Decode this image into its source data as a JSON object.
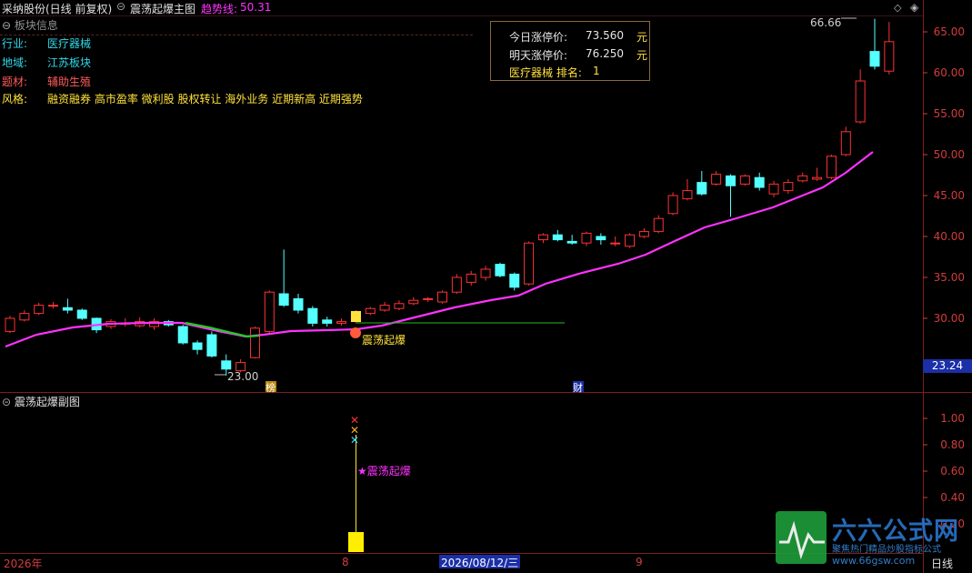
{
  "title_bar": {
    "stock": "采纳股份(日线 前复权)",
    "indicator_main": "震荡起爆主图",
    "trend_label": "趋势线:",
    "trend_value": "50.31"
  },
  "sector_panel": {
    "title": "板块信息",
    "rows": [
      {
        "key": "行业:",
        "value": "医疗器械"
      },
      {
        "key": "地域:",
        "value": "江苏板块"
      },
      {
        "key": "题材:",
        "value": "辅助生殖"
      },
      {
        "key": "风格:",
        "value": "融资融券 高市盈率 微利股 股权转让 海外业务 近期新高 近期强势"
      }
    ]
  },
  "limit_popup": {
    "today_label": "今日涨停价:",
    "today_value": "73.560",
    "today_unit": "元",
    "tomorrow_label": "明天涨停价:",
    "tomorrow_value": "76.250",
    "tomorrow_unit": "元",
    "rank_label": "医疗器械 排名:",
    "rank_value": "1"
  },
  "main_chart": {
    "price_ticks": [
      "65.00",
      "60.00",
      "55.00",
      "50.00",
      "45.00",
      "40.00",
      "35.00",
      "30.00"
    ],
    "high_marker": "66.66",
    "low_marker": "23.00",
    "current_price": "23.24",
    "signal_label": "震荡起爆",
    "event_tag_1": "榜",
    "event_tag_2": "财"
  },
  "sub_chart": {
    "title": "震荡起爆副图",
    "ticks": [
      "1.00",
      "0.80",
      "0.60",
      "0.40",
      "0.20"
    ],
    "signal_label": "★震荡起爆"
  },
  "bottom_bar": {
    "year": "2026年",
    "month_8": "8",
    "date_highlight": "2026/08/12/三",
    "month_9": "9",
    "period": "日线"
  },
  "watermark": {
    "logo_text": "六六公式网",
    "slogan": "聚焦热门精品炒股指标公式",
    "url": "www.66gsw.com"
  },
  "colors": {
    "up": "#ff3232",
    "down": "#54ffff",
    "ma": "#ff32ff",
    "ma_green": "#22cc22",
    "axis": "#d23c3c",
    "yellow": "#ffe23a",
    "magenta": "#ff32ff"
  }
}
